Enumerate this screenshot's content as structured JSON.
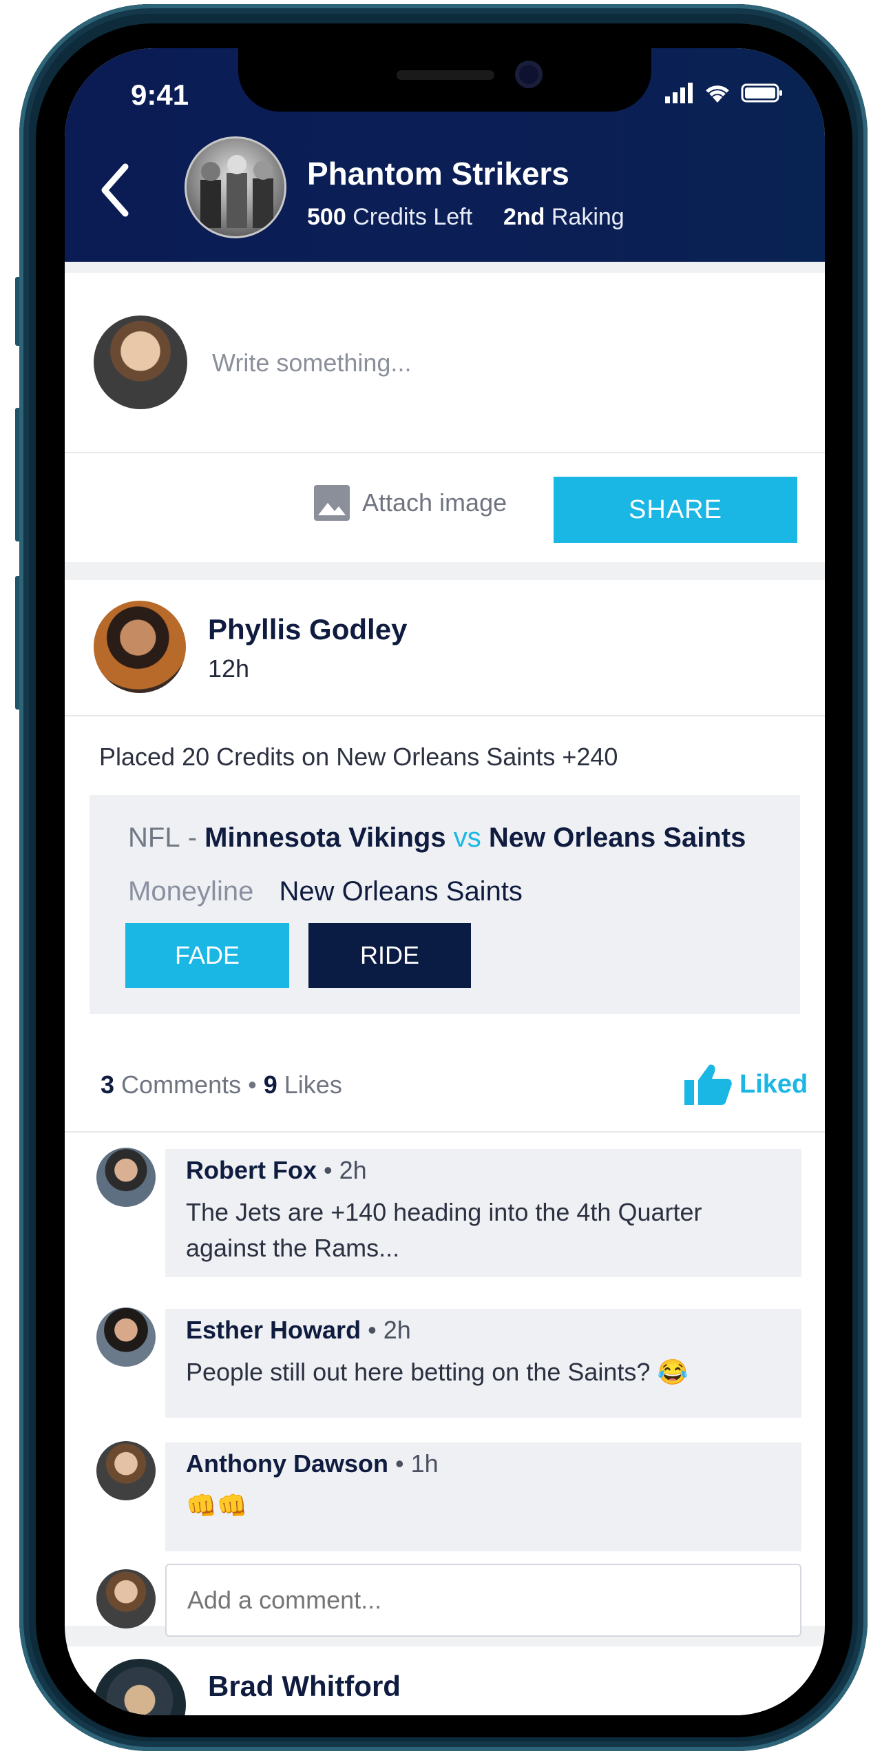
{
  "status_bar": {
    "time": "9:41"
  },
  "header": {
    "team_name": "Phantom Strikers",
    "credits_value": "500",
    "credits_label": "Credits Left",
    "rank_value": "2nd",
    "rank_label": "Raking"
  },
  "composer": {
    "placeholder": "Write something...",
    "attach_label": "Attach image",
    "share_label": "SHARE"
  },
  "post": {
    "author": "Phyllis Godley",
    "time": "12h",
    "text": "Placed 20 Credits on New Orleans Saints +240",
    "bet": {
      "league": "NFL",
      "separator": "-",
      "team_a": "Minnesota Vikings",
      "vs": "vs",
      "team_b": "New Orleans Saints",
      "market_label": "Moneyline",
      "selection": "New Orleans Saints",
      "fade_label": "FADE",
      "ride_label": "RIDE"
    },
    "comments_count": "3",
    "comments_label": "Comments",
    "stats_separator": "•",
    "likes_count": "9",
    "likes_label": "Likes",
    "liked_label": "Liked",
    "comments": [
      {
        "name": "Robert Fox",
        "time": "2h",
        "line1": "The Jets are +140 heading into the 4th Quarter",
        "line2": "against the Rams..."
      },
      {
        "name": "Esther Howard",
        "time": "2h",
        "line1": "People still out here betting on the Saints? 😂",
        "line2": ""
      },
      {
        "name": "Anthony Dawson",
        "time": "1h",
        "line1": "👊👊",
        "line2": ""
      }
    ],
    "comment_placeholder": "Add a comment..."
  },
  "next_post": {
    "author": "Brad Whitford"
  },
  "colors": {
    "navy": "#0b1c55",
    "accent": "#1ab7e4",
    "dark_button": "#0b1c44"
  }
}
